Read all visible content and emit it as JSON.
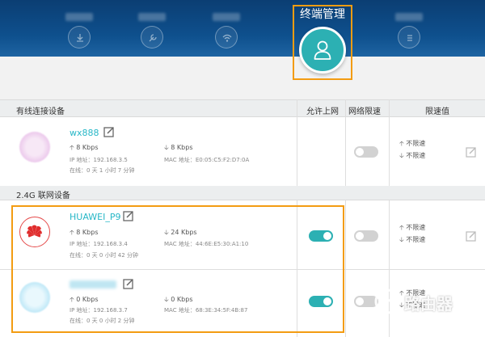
{
  "header": {
    "active_tab_label": "终端管理",
    "active_tab_icon": "user-icon",
    "other_tab_icons": [
      "download-icon",
      "tools-icon",
      "wifi-icon",
      "list-icon"
    ]
  },
  "table": {
    "columns": {
      "device": "有线连接设备",
      "allow": "允许上网",
      "speed_limit": "网络限速",
      "limit_value": "限速值"
    },
    "section_24g": "2.4G 联网设备"
  },
  "devices": [
    {
      "name": "wx888",
      "upload": "8 Kbps",
      "download": "8 Kbps",
      "ip": "IP 地址：192.168.3.5",
      "mac": "MAC 地址：E0:05:C5:F2:D7:0A",
      "online": "在线：0 天 1 小时 7 分钟",
      "allow_on": false,
      "limit_up": "不限速",
      "limit_down": "不限速"
    },
    {
      "name": "HUAWEI_P9",
      "upload": "8 Kbps",
      "download": "24 Kbps",
      "ip": "IP 地址：192.168.3.4",
      "mac": "MAC 地址：44:6E:E5:30:A1:10",
      "online": "在线：0 天 0 小时 42 分钟",
      "allow_on": true,
      "limit_up": "不限速",
      "limit_down": "不限速"
    },
    {
      "name": "",
      "upload": "0 Kbps",
      "download": "0 Kbps",
      "ip": "IP 地址：192.168.3.7",
      "mac": "MAC 地址：68:3E:34:5F:4B:87",
      "online": "在线：0 天 0 小时 2 分钟",
      "allow_on": true,
      "limit_up": "不限速",
      "limit_down": "不限速"
    }
  ],
  "watermark": "路由器",
  "colors": {
    "accent": "#2cb0b3",
    "highlight": "#f39c12",
    "header": "#0e4f8c",
    "link": "#27b7c7"
  }
}
